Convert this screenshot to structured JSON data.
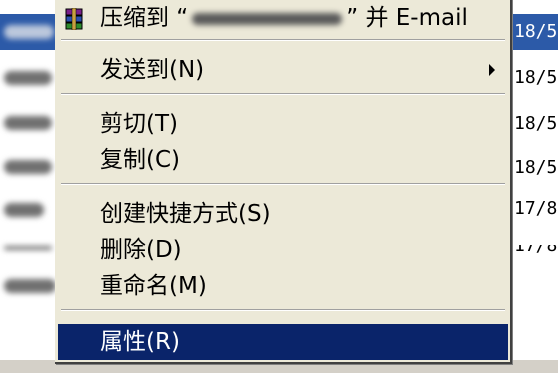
{
  "file_list": {
    "dates": [
      "18/5",
      "18/5",
      "18/5",
      "18/5",
      "17/8",
      "17/8"
    ]
  },
  "menu": {
    "compress_email": {
      "prefix": "压缩到 “",
      "suffix": "” 并 E-mail"
    },
    "send_to": "发送到(N)",
    "cut": "剪切(T)",
    "copy": "复制(C)",
    "create_shortcut": "创建快捷方式(S)",
    "delete": "删除(D)",
    "rename": "重命名(M)",
    "properties": "属性(R)"
  },
  "icons": {
    "compress": "winrar-books-icon",
    "submenu": "submenu-arrow-icon"
  },
  "colors": {
    "menu_bg": "#ece9d8",
    "highlight": "#0a246a",
    "selected_row": "#2c5aa8"
  }
}
